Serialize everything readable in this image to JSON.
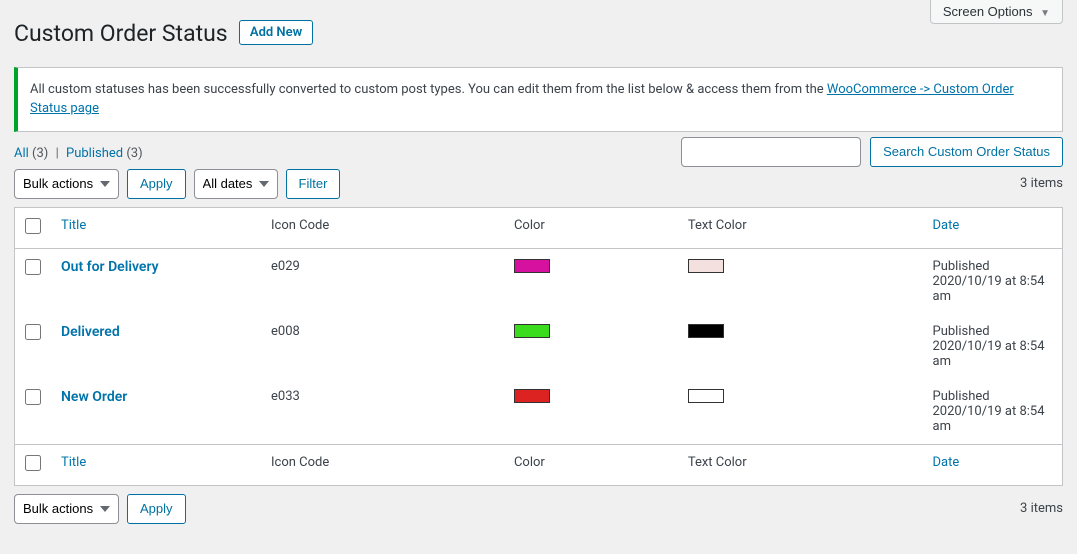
{
  "screenOptions": {
    "label": "Screen Options"
  },
  "page": {
    "heading": "Custom Order Status",
    "addNew": "Add New"
  },
  "notice": {
    "textBefore": "All custom statuses has been successfully converted to custom post types. You can edit them from the list below & access them from the ",
    "linkText": "WooCommerce -> Custom Order Status page"
  },
  "subsubsub": {
    "allLabel": "All",
    "allCount": "(3)",
    "publishedLabel": "Published",
    "publishedCount": "(3)"
  },
  "search": {
    "buttonLabel": "Search Custom Order Status"
  },
  "tablenav": {
    "bulkActionsLabel": "Bulk actions",
    "applyLabel": "Apply",
    "allDatesLabel": "All dates",
    "filterLabel": "Filter",
    "itemsCount": "3 items"
  },
  "columns": {
    "title": "Title",
    "iconCode": "Icon Code",
    "color": "Color",
    "textColor": "Text Color",
    "date": "Date"
  },
  "rows": [
    {
      "title": "Out for Delivery",
      "iconCode": "e029",
      "color": "#d6119f",
      "textColor": "#f5e0e0",
      "date": "Published\n2020/10/19 at 8:54 am"
    },
    {
      "title": "Delivered",
      "iconCode": "e008",
      "color": "#3bdc1d",
      "textColor": "#000000",
      "date": "Published\n2020/10/19 at 8:54 am"
    },
    {
      "title": "New Order",
      "iconCode": "e033",
      "color": "#dd2222",
      "textColor": "#ffffff",
      "date": "Published\n2020/10/19 at 8:54 am"
    }
  ]
}
